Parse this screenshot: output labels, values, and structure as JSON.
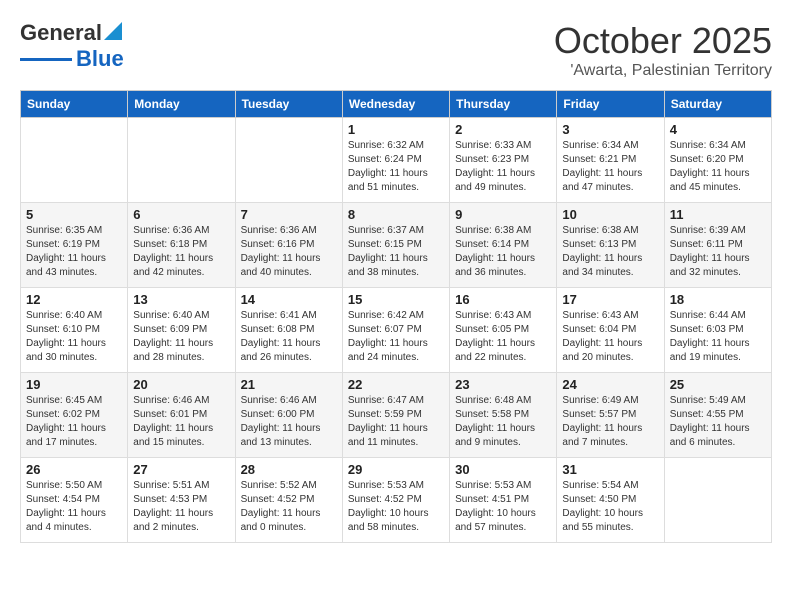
{
  "logo": {
    "line1": "General",
    "line2": "Blue"
  },
  "header": {
    "month": "October 2025",
    "location": "'Awarta, Palestinian Territory"
  },
  "weekdays": [
    "Sunday",
    "Monday",
    "Tuesday",
    "Wednesday",
    "Thursday",
    "Friday",
    "Saturday"
  ],
  "weeks": [
    [
      {
        "day": "",
        "info": ""
      },
      {
        "day": "",
        "info": ""
      },
      {
        "day": "",
        "info": ""
      },
      {
        "day": "1",
        "info": "Sunrise: 6:32 AM\nSunset: 6:24 PM\nDaylight: 11 hours\nand 51 minutes."
      },
      {
        "day": "2",
        "info": "Sunrise: 6:33 AM\nSunset: 6:23 PM\nDaylight: 11 hours\nand 49 minutes."
      },
      {
        "day": "3",
        "info": "Sunrise: 6:34 AM\nSunset: 6:21 PM\nDaylight: 11 hours\nand 47 minutes."
      },
      {
        "day": "4",
        "info": "Sunrise: 6:34 AM\nSunset: 6:20 PM\nDaylight: 11 hours\nand 45 minutes."
      }
    ],
    [
      {
        "day": "5",
        "info": "Sunrise: 6:35 AM\nSunset: 6:19 PM\nDaylight: 11 hours\nand 43 minutes."
      },
      {
        "day": "6",
        "info": "Sunrise: 6:36 AM\nSunset: 6:18 PM\nDaylight: 11 hours\nand 42 minutes."
      },
      {
        "day": "7",
        "info": "Sunrise: 6:36 AM\nSunset: 6:16 PM\nDaylight: 11 hours\nand 40 minutes."
      },
      {
        "day": "8",
        "info": "Sunrise: 6:37 AM\nSunset: 6:15 PM\nDaylight: 11 hours\nand 38 minutes."
      },
      {
        "day": "9",
        "info": "Sunrise: 6:38 AM\nSunset: 6:14 PM\nDaylight: 11 hours\nand 36 minutes."
      },
      {
        "day": "10",
        "info": "Sunrise: 6:38 AM\nSunset: 6:13 PM\nDaylight: 11 hours\nand 34 minutes."
      },
      {
        "day": "11",
        "info": "Sunrise: 6:39 AM\nSunset: 6:11 PM\nDaylight: 11 hours\nand 32 minutes."
      }
    ],
    [
      {
        "day": "12",
        "info": "Sunrise: 6:40 AM\nSunset: 6:10 PM\nDaylight: 11 hours\nand 30 minutes."
      },
      {
        "day": "13",
        "info": "Sunrise: 6:40 AM\nSunset: 6:09 PM\nDaylight: 11 hours\nand 28 minutes."
      },
      {
        "day": "14",
        "info": "Sunrise: 6:41 AM\nSunset: 6:08 PM\nDaylight: 11 hours\nand 26 minutes."
      },
      {
        "day": "15",
        "info": "Sunrise: 6:42 AM\nSunset: 6:07 PM\nDaylight: 11 hours\nand 24 minutes."
      },
      {
        "day": "16",
        "info": "Sunrise: 6:43 AM\nSunset: 6:05 PM\nDaylight: 11 hours\nand 22 minutes."
      },
      {
        "day": "17",
        "info": "Sunrise: 6:43 AM\nSunset: 6:04 PM\nDaylight: 11 hours\nand 20 minutes."
      },
      {
        "day": "18",
        "info": "Sunrise: 6:44 AM\nSunset: 6:03 PM\nDaylight: 11 hours\nand 19 minutes."
      }
    ],
    [
      {
        "day": "19",
        "info": "Sunrise: 6:45 AM\nSunset: 6:02 PM\nDaylight: 11 hours\nand 17 minutes."
      },
      {
        "day": "20",
        "info": "Sunrise: 6:46 AM\nSunset: 6:01 PM\nDaylight: 11 hours\nand 15 minutes."
      },
      {
        "day": "21",
        "info": "Sunrise: 6:46 AM\nSunset: 6:00 PM\nDaylight: 11 hours\nand 13 minutes."
      },
      {
        "day": "22",
        "info": "Sunrise: 6:47 AM\nSunset: 5:59 PM\nDaylight: 11 hours\nand 11 minutes."
      },
      {
        "day": "23",
        "info": "Sunrise: 6:48 AM\nSunset: 5:58 PM\nDaylight: 11 hours\nand 9 minutes."
      },
      {
        "day": "24",
        "info": "Sunrise: 6:49 AM\nSunset: 5:57 PM\nDaylight: 11 hours\nand 7 minutes."
      },
      {
        "day": "25",
        "info": "Sunrise: 5:49 AM\nSunset: 4:55 PM\nDaylight: 11 hours\nand 6 minutes."
      }
    ],
    [
      {
        "day": "26",
        "info": "Sunrise: 5:50 AM\nSunset: 4:54 PM\nDaylight: 11 hours\nand 4 minutes."
      },
      {
        "day": "27",
        "info": "Sunrise: 5:51 AM\nSunset: 4:53 PM\nDaylight: 11 hours\nand 2 minutes."
      },
      {
        "day": "28",
        "info": "Sunrise: 5:52 AM\nSunset: 4:52 PM\nDaylight: 11 hours\nand 0 minutes."
      },
      {
        "day": "29",
        "info": "Sunrise: 5:53 AM\nSunset: 4:52 PM\nDaylight: 10 hours\nand 58 minutes."
      },
      {
        "day": "30",
        "info": "Sunrise: 5:53 AM\nSunset: 4:51 PM\nDaylight: 10 hours\nand 57 minutes."
      },
      {
        "day": "31",
        "info": "Sunrise: 5:54 AM\nSunset: 4:50 PM\nDaylight: 10 hours\nand 55 minutes."
      },
      {
        "day": "",
        "info": ""
      }
    ]
  ]
}
